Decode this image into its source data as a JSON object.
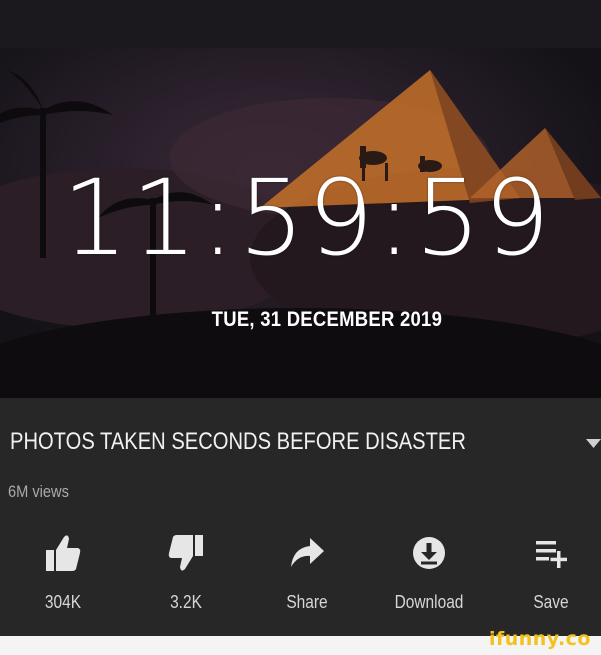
{
  "lockscreen": {
    "time": "11:59:59",
    "date": "TUE, 31 DECEMBER 2019"
  },
  "video": {
    "title": "PHOTOS TAKEN SECONDS BEFORE DISASTER",
    "views": "6M views"
  },
  "actions": [
    {
      "icon": "thumbs-up-icon",
      "label": "304K"
    },
    {
      "icon": "thumbs-down-icon",
      "label": "3.2K"
    },
    {
      "icon": "share-icon",
      "label": "Share"
    },
    {
      "icon": "download-icon",
      "label": "Download"
    },
    {
      "icon": "save-to-playlist-icon",
      "label": "Save"
    }
  ],
  "watermark": "ifunny.co",
  "colors": {
    "panel": "#272727",
    "wallpaper_dark": "#141217",
    "pyramid": "#c5712a",
    "watermark": "#f3c21c"
  }
}
